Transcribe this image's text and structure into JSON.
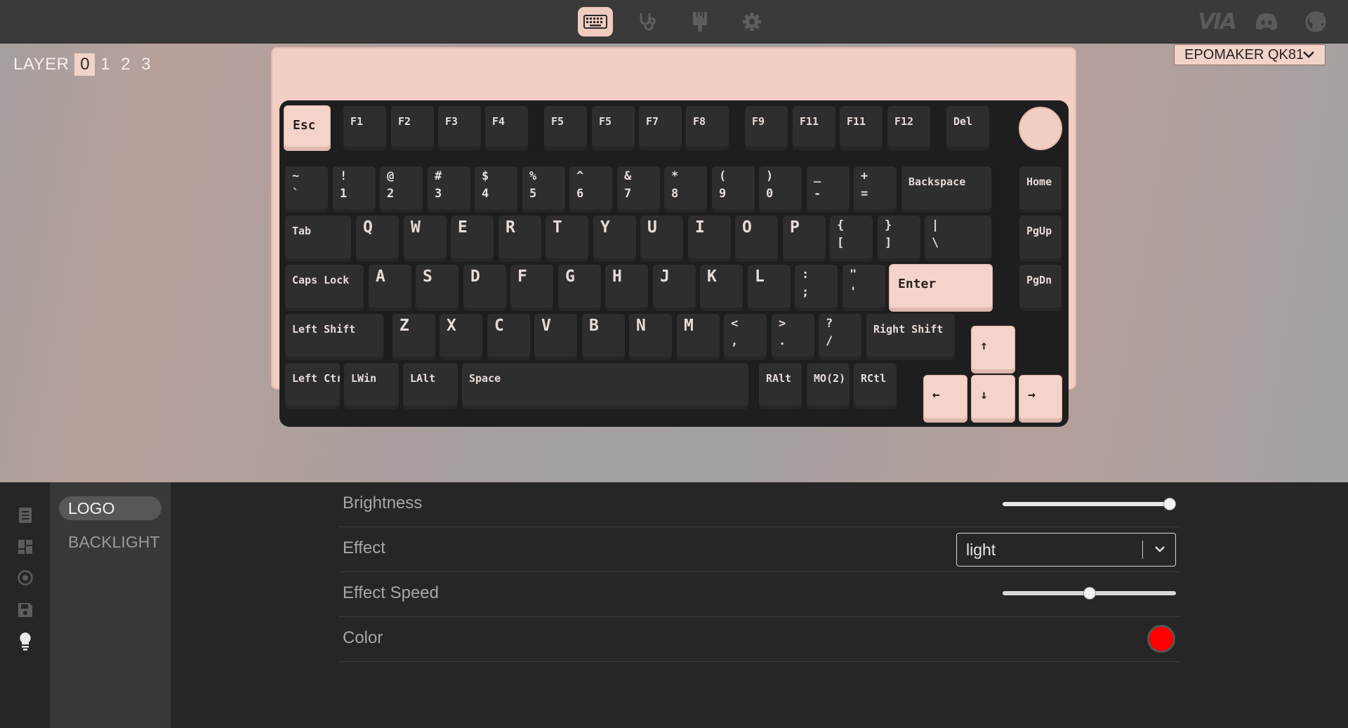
{
  "topbar": {
    "nav": [
      {
        "name": "keyboard-icon",
        "active": true
      },
      {
        "name": "stethoscope-icon",
        "active": false
      },
      {
        "name": "paintbrush-icon",
        "active": false
      },
      {
        "name": "gear-icon",
        "active": false
      }
    ],
    "brand": "VIA",
    "links": [
      "discord-icon",
      "github-icon"
    ]
  },
  "layer": {
    "label": "LAYER",
    "options": [
      "0",
      "1",
      "2",
      "3"
    ],
    "selected": "0"
  },
  "device_selector": {
    "value": "EPOMAKER QK81"
  },
  "keyboard": {
    "rows": {
      "fn": [
        "Esc",
        "F1",
        "F2",
        "F3",
        "F4",
        "F5",
        "F5",
        "F7",
        "F8",
        "F9",
        "F11",
        "F11",
        "F12",
        "Del"
      ],
      "number": [
        "~\n`",
        "!\n1",
        "@\n2",
        "#\n3",
        "$\n4",
        "%\n5",
        "^\n6",
        "&\n7",
        "*\n8",
        "(\n9",
        ")\n0",
        "_\n-",
        "+\n=",
        "Backspace",
        "Home"
      ],
      "tab": [
        "Tab",
        "Q",
        "W",
        "E",
        "R",
        "T",
        "Y",
        "U",
        "I",
        "O",
        "P",
        "{\n[",
        "}\n]",
        "|\n\\",
        "PgUp"
      ],
      "caps": [
        "Caps Lock",
        "A",
        "S",
        "D",
        "F",
        "G",
        "H",
        "J",
        "K",
        "L",
        ":\n;",
        "\"\n'",
        "Enter",
        "PgDn"
      ],
      "shift": [
        "Left Shift",
        "Z",
        "X",
        "C",
        "V",
        "B",
        "N",
        "M",
        "<\n,",
        ">\n.",
        "?\n/",
        "Right Shift",
        "↑"
      ],
      "bottom": [
        "Left Ctrl",
        "LWin",
        "LAlt",
        "Space",
        "RAlt",
        "MO(2)",
        "RCtl",
        "←",
        "↓",
        "→"
      ]
    },
    "colors": {
      "case": "#f2cec4",
      "plate": "#1e1e1e",
      "keycap": "#2e2e2e",
      "accent_keycap": "#f4d4ca"
    }
  },
  "sidebar": {
    "icons": [
      "keymap-icon",
      "macros-icon",
      "layouts-icon",
      "save-icon",
      "lighting-icon"
    ],
    "active_icon": "lighting-icon"
  },
  "submenu": {
    "items": [
      "LOGO",
      "BACKLIGHT"
    ],
    "selected": "LOGO"
  },
  "lighting": {
    "brightness": {
      "label": "Brightness",
      "value_pct": 100
    },
    "effect": {
      "label": "Effect",
      "value": "light"
    },
    "effect_speed": {
      "label": "Effect Speed",
      "value_pct": 50
    },
    "color": {
      "label": "Color",
      "value": "#ff0000"
    }
  }
}
